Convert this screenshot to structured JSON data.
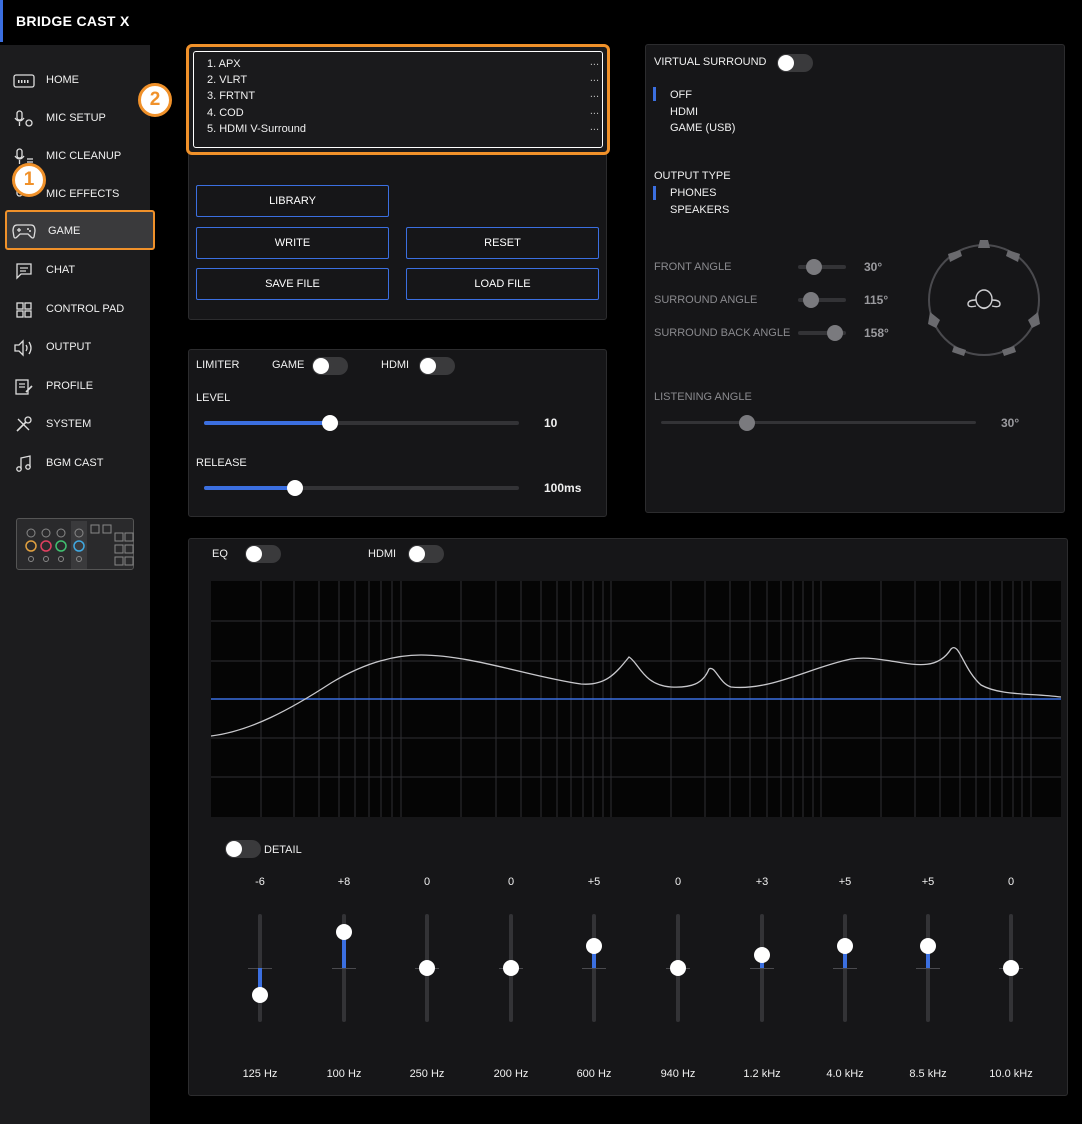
{
  "app": {
    "title": "BRIDGE CAST X"
  },
  "sidebar": {
    "items": [
      {
        "label": "HOME",
        "icon": "home-icon"
      },
      {
        "label": "MIC SETUP",
        "icon": "mic-setup-icon"
      },
      {
        "label": "MIC CLEANUP",
        "icon": "mic-cleanup-icon"
      },
      {
        "label": "MIC EFFECTS",
        "icon": "mic-effects-icon"
      },
      {
        "label": "GAME",
        "icon": "gamepad-icon",
        "active": true
      },
      {
        "label": "CHAT",
        "icon": "chat-icon"
      },
      {
        "label": "CONTROL PAD",
        "icon": "control-pad-icon"
      },
      {
        "label": "OUTPUT",
        "icon": "speaker-icon"
      },
      {
        "label": "PROFILE",
        "icon": "profile-icon"
      },
      {
        "label": "SYSTEM",
        "icon": "system-icon"
      },
      {
        "label": "BGM CAST",
        "icon": "music-note-icon"
      }
    ]
  },
  "callouts": {
    "one": "1",
    "two": "2"
  },
  "presets": {
    "items": [
      {
        "label": "1. APX",
        "more": "..."
      },
      {
        "label": "2. VLRT",
        "more": "..."
      },
      {
        "label": "3. FRTNT",
        "more": "..."
      },
      {
        "label": "4. COD",
        "more": "..."
      },
      {
        "label": "5. HDMI V-Surround",
        "more": "..."
      }
    ]
  },
  "buttons": {
    "library": "LIBRARY",
    "write": "WRITE",
    "reset": "RESET",
    "save_file": "SAVE FILE",
    "load_file": "LOAD FILE"
  },
  "limiter": {
    "title": "LIMITER",
    "game_label": "GAME",
    "hdmi_label": "HDMI",
    "level_label": "LEVEL",
    "level_value": "10",
    "level_fraction": 0.4,
    "release_label": "RELEASE",
    "release_value": "100ms",
    "release_fraction": 0.29
  },
  "virtual_surround": {
    "title": "VIRTUAL SURROUND",
    "sources": [
      "OFF",
      "HDMI",
      "GAME (USB)"
    ],
    "selected_source": "OFF",
    "output_type_label": "OUTPUT TYPE",
    "output_types": [
      "PHONES",
      "SPEAKERS"
    ],
    "selected_output": "PHONES",
    "front_angle_label": "FRONT ANGLE",
    "front_angle_value": "30°",
    "surround_angle_label": "SURROUND ANGLE",
    "surround_angle_value": "115°",
    "surround_back_angle_label": "SURROUND BACK ANGLE",
    "surround_back_angle_value": "158°",
    "listening_angle_label": "LISTENING ANGLE",
    "listening_angle_value": "30°"
  },
  "eq": {
    "title": "EQ",
    "hdmi_label": "HDMI",
    "detail_label": "DETAIL",
    "bands": [
      {
        "gain": "-6",
        "gain_num": -6,
        "freq": "125 Hz"
      },
      {
        "gain": "+8",
        "gain_num": 8,
        "freq": "100 Hz"
      },
      {
        "gain": "0",
        "gain_num": 0,
        "freq": "250 Hz"
      },
      {
        "gain": "0",
        "gain_num": 0,
        "freq": "200 Hz"
      },
      {
        "gain": "+5",
        "gain_num": 5,
        "freq": "600 Hz"
      },
      {
        "gain": "0",
        "gain_num": 0,
        "freq": "940 Hz"
      },
      {
        "gain": "+3",
        "gain_num": 3,
        "freq": "1.2 kHz"
      },
      {
        "gain": "+5",
        "gain_num": 5,
        "freq": "4.0 kHz"
      },
      {
        "gain": "+5",
        "gain_num": 5,
        "freq": "8.5 kHz"
      },
      {
        "gain": "0",
        "gain_num": 0,
        "freq": "10.0 kHz"
      }
    ]
  },
  "colors": {
    "accent": "#3b6fe0",
    "highlight": "#f0912a"
  }
}
